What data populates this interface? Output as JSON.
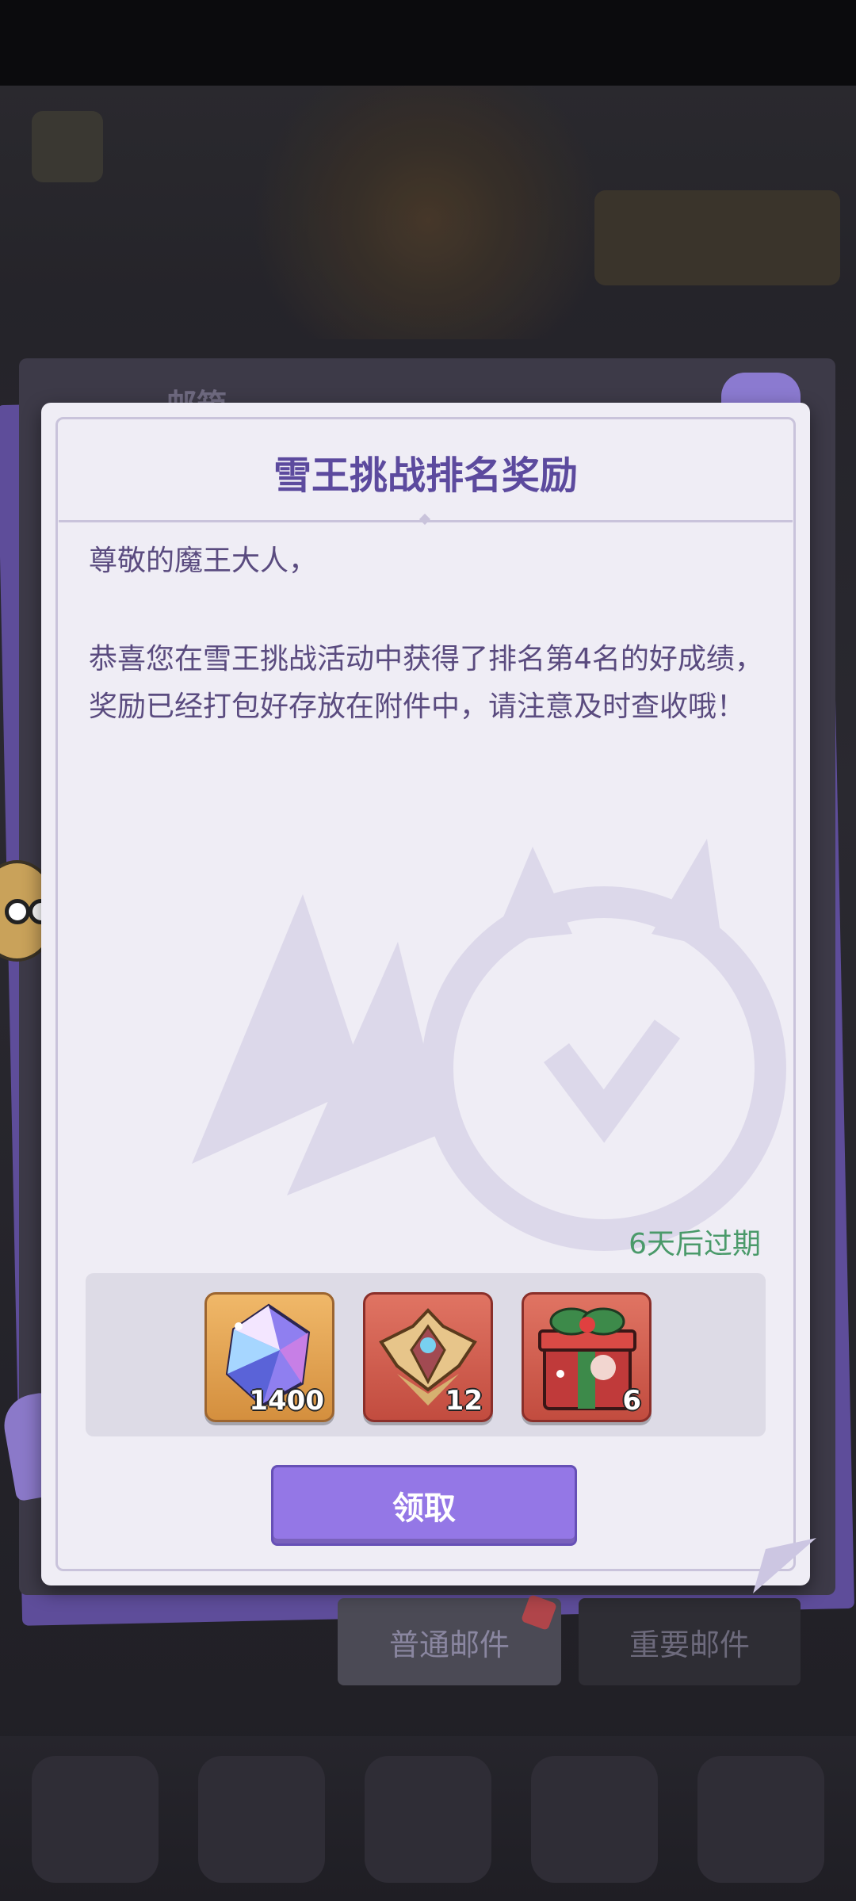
{
  "mailbox": {
    "title": "邮箱",
    "tabs": [
      {
        "label": "普通邮件"
      },
      {
        "label": "重要邮件"
      }
    ]
  },
  "mail": {
    "title": "雪王挑战排名奖励",
    "greeting": "尊敬的魔王大人，",
    "body": "恭喜您在雪王挑战活动中获得了排名第4名的好成绩，奖励已经打包好存放在附件中，请注意及时查收哦！",
    "expiry": "6天后过期",
    "claim_label": "领取",
    "rewards": [
      {
        "icon": "crystal-gem-icon",
        "count": "1400",
        "frame": "gold"
      },
      {
        "icon": "golden-crest-icon",
        "count": "12",
        "frame": "red"
      },
      {
        "icon": "christmas-gift-box-icon",
        "count": "6",
        "frame": "red"
      }
    ]
  },
  "colors": {
    "accent": "#9477e6",
    "title": "#5c4a9e",
    "expiry": "#4a9a6a",
    "paper": "#efedf5"
  }
}
